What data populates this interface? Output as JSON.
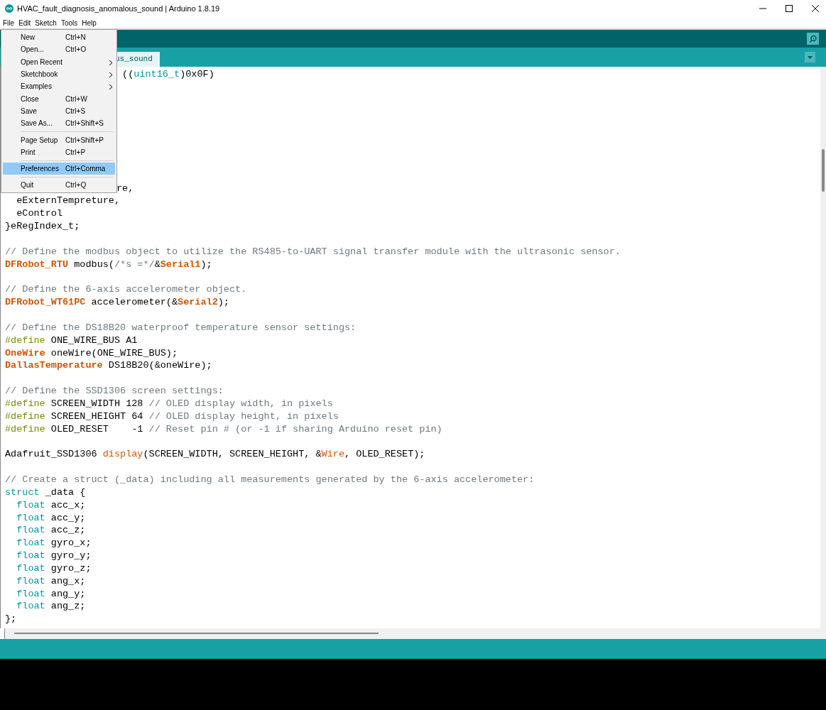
{
  "window": {
    "title": "HVAC_fault_diagnosis_anomalous_sound | Arduino 1.8.19"
  },
  "menu_bar": [
    "File",
    "Edit",
    "Sketch",
    "Tools",
    "Help"
  ],
  "file_menu": [
    {
      "kind": "item",
      "label": "New",
      "shortcut": "Ctrl+N",
      "submenu": false,
      "selected": false
    },
    {
      "kind": "item",
      "label": "Open...",
      "shortcut": "Ctrl+O",
      "submenu": false,
      "selected": false
    },
    {
      "kind": "item",
      "label": "Open Recent",
      "submenu": true,
      "selected": false
    },
    {
      "kind": "item",
      "label": "Sketchbook",
      "submenu": true,
      "selected": false
    },
    {
      "kind": "item",
      "label": "Examples",
      "submenu": true,
      "selected": false
    },
    {
      "kind": "item",
      "label": "Close",
      "shortcut": "Ctrl+W",
      "submenu": false,
      "selected": false
    },
    {
      "kind": "item",
      "label": "Save",
      "shortcut": "Ctrl+S",
      "submenu": false,
      "selected": false
    },
    {
      "kind": "item",
      "label": "Save As...",
      "shortcut": "Ctrl+Shift+S",
      "submenu": false,
      "selected": false
    },
    {
      "kind": "separator"
    },
    {
      "kind": "item",
      "label": "Page Setup",
      "shortcut": "Ctrl+Shift+P",
      "submenu": false,
      "selected": false
    },
    {
      "kind": "item",
      "label": "Print",
      "shortcut": "Ctrl+P",
      "submenu": false,
      "selected": false
    },
    {
      "kind": "separator"
    },
    {
      "kind": "item",
      "label": "Preferences",
      "shortcut": "Ctrl+Comma",
      "submenu": false,
      "selected": true
    },
    {
      "kind": "separator"
    },
    {
      "kind": "item",
      "label": "Quit",
      "shortcut": "Ctrl+Q",
      "submenu": false,
      "selected": false
    }
  ],
  "tabs": [
    {
      "label": "us_sound",
      "selected": true
    }
  ],
  "code_lines": [
    {
      "kind": "partial",
      "tokens": [
        {
          "kind": "plain",
          "text": " (("
        },
        {
          "kind": "constant",
          "text": "uint16_t"
        },
        {
          "kind": "plain",
          "text": ")0x0F)"
        }
      ]
    },
    {
      "kind": "blank"
    },
    {
      "kind": "blank"
    },
    {
      "kind": "blank"
    },
    {
      "kind": "blank"
    },
    {
      "kind": "blank"
    },
    {
      "kind": "blank"
    },
    {
      "kind": "blank"
    },
    {
      "kind": "blank"
    },
    {
      "kind": "partial",
      "tokens": [
        {
          "kind": "plain",
          "text": "re,"
        }
      ]
    },
    {
      "kind": "code",
      "indented": true,
      "tokens": [
        {
          "kind": "plain",
          "text": "eExternTempreture,"
        }
      ]
    },
    {
      "kind": "code",
      "indented": true,
      "tokens": [
        {
          "kind": "plain",
          "text": "eControl"
        }
      ]
    },
    {
      "kind": "code",
      "tokens": [
        {
          "kind": "plain",
          "text": "}eRegIndex_t;"
        }
      ]
    },
    {
      "kind": "blank"
    },
    {
      "kind": "code",
      "tokens": [
        {
          "kind": "comment",
          "text": "// Define the modbus object to utilize the RS485-to-UART signal transfer module with the ultrasonic sensor."
        }
      ]
    },
    {
      "kind": "code",
      "tokens": [
        {
          "kind": "type",
          "text": "DFRobot_RTU"
        },
        {
          "kind": "plain",
          "text": " modbus("
        },
        {
          "kind": "comment",
          "text": "/*s =*/"
        },
        {
          "kind": "plain",
          "text": "&"
        },
        {
          "kind": "type",
          "text": "Serial1"
        },
        {
          "kind": "plain",
          "text": ");"
        }
      ]
    },
    {
      "kind": "blank"
    },
    {
      "kind": "code",
      "tokens": [
        {
          "kind": "comment",
          "text": "// Define the 6-axis accelerometer object."
        }
      ]
    },
    {
      "kind": "code",
      "tokens": [
        {
          "kind": "type",
          "text": "DFRobot_WT61PC"
        },
        {
          "kind": "plain",
          "text": " accelerometer(&"
        },
        {
          "kind": "type",
          "text": "Serial2"
        },
        {
          "kind": "plain",
          "text": ");"
        }
      ]
    },
    {
      "kind": "blank"
    },
    {
      "kind": "code",
      "tokens": [
        {
          "kind": "comment",
          "text": "// Define the DS18B20 waterproof temperature sensor settings:"
        }
      ]
    },
    {
      "kind": "code",
      "tokens": [
        {
          "kind": "preproc",
          "text": "#define"
        },
        {
          "kind": "plain",
          "text": " ONE_WIRE_BUS A1"
        }
      ]
    },
    {
      "kind": "code",
      "tokens": [
        {
          "kind": "type",
          "text": "OneWire"
        },
        {
          "kind": "plain",
          "text": " oneWire(ONE_WIRE_BUS);"
        }
      ]
    },
    {
      "kind": "code",
      "tokens": [
        {
          "kind": "type",
          "text": "DallasTemperature"
        },
        {
          "kind": "plain",
          "text": " DS18B20(&oneWire);"
        }
      ]
    },
    {
      "kind": "blank"
    },
    {
      "kind": "code",
      "tokens": [
        {
          "kind": "comment",
          "text": "// Define the SSD1306 screen settings:"
        }
      ]
    },
    {
      "kind": "code",
      "tokens": [
        {
          "kind": "preproc",
          "text": "#define"
        },
        {
          "kind": "plain",
          "text": " SCREEN_WIDTH 128 "
        },
        {
          "kind": "comment",
          "text": "// OLED display width, in pixels"
        }
      ]
    },
    {
      "kind": "code",
      "tokens": [
        {
          "kind": "preproc",
          "text": "#define"
        },
        {
          "kind": "plain",
          "text": " SCREEN_HEIGHT 64 "
        },
        {
          "kind": "comment",
          "text": "// OLED display height, in pixels"
        }
      ]
    },
    {
      "kind": "code",
      "tokens": [
        {
          "kind": "preproc",
          "text": "#define"
        },
        {
          "kind": "plain",
          "text": " OLED_RESET    -1 "
        },
        {
          "kind": "comment",
          "text": "// Reset pin # (or -1 if sharing Arduino reset pin)"
        }
      ]
    },
    {
      "kind": "blank"
    },
    {
      "kind": "code",
      "tokens": [
        {
          "kind": "plain",
          "text": "Adafruit_SSD1306 "
        },
        {
          "kind": "function",
          "text": "display"
        },
        {
          "kind": "plain",
          "text": "(SCREEN_WIDTH, SCREEN_HEIGHT, &"
        },
        {
          "kind": "function",
          "text": "Wire"
        },
        {
          "kind": "plain",
          "text": ", OLED_RESET);"
        }
      ]
    },
    {
      "kind": "blank"
    },
    {
      "kind": "code",
      "tokens": [
        {
          "kind": "comment",
          "text": "// Create a struct (_data) including all measurements generated by the 6-axis accelerometer:"
        }
      ]
    },
    {
      "kind": "code",
      "tokens": [
        {
          "kind": "keyword",
          "text": "struct"
        },
        {
          "kind": "plain",
          "text": " _data {"
        }
      ]
    },
    {
      "kind": "code",
      "indented": true,
      "tokens": [
        {
          "kind": "keyword",
          "text": "float"
        },
        {
          "kind": "plain",
          "text": " acc_x;"
        }
      ]
    },
    {
      "kind": "code",
      "indented": true,
      "tokens": [
        {
          "kind": "keyword",
          "text": "float"
        },
        {
          "kind": "plain",
          "text": " acc_y;"
        }
      ]
    },
    {
      "kind": "code",
      "indented": true,
      "tokens": [
        {
          "kind": "keyword",
          "text": "float"
        },
        {
          "kind": "plain",
          "text": " acc_z;"
        }
      ]
    },
    {
      "kind": "code",
      "indented": true,
      "tokens": [
        {
          "kind": "keyword",
          "text": "float"
        },
        {
          "kind": "plain",
          "text": " gyro_x;"
        }
      ]
    },
    {
      "kind": "code",
      "indented": true,
      "tokens": [
        {
          "kind": "keyword",
          "text": "float"
        },
        {
          "kind": "plain",
          "text": " gyro_y;"
        }
      ]
    },
    {
      "kind": "code",
      "indented": true,
      "tokens": [
        {
          "kind": "keyword",
          "text": "float"
        },
        {
          "kind": "plain",
          "text": " gyro_z;"
        }
      ]
    },
    {
      "kind": "code",
      "indented": true,
      "tokens": [
        {
          "kind": "keyword",
          "text": "float"
        },
        {
          "kind": "plain",
          "text": " ang_x;"
        }
      ]
    },
    {
      "kind": "code",
      "indented": true,
      "tokens": [
        {
          "kind": "keyword",
          "text": "float"
        },
        {
          "kind": "plain",
          "text": " ang_y;"
        }
      ]
    },
    {
      "kind": "code",
      "indented": true,
      "tokens": [
        {
          "kind": "keyword",
          "text": "float"
        },
        {
          "kind": "plain",
          "text": " ang_z;"
        }
      ]
    },
    {
      "kind": "code",
      "tokens": [
        {
          "kind": "plain",
          "text": "};"
        }
      ]
    }
  ]
}
